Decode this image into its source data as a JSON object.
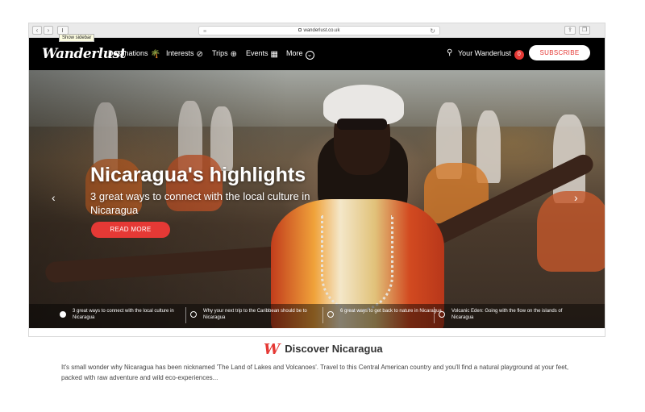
{
  "browser": {
    "url": "wanderlust.co.uk",
    "tooltip": "Show sidebar",
    "back_glyph": "‹",
    "forward_glyph": "›",
    "reload_glyph": "↻",
    "new_tab_glyph": "+"
  },
  "site": {
    "logo": "Wanderlust",
    "nav": [
      {
        "label": "Destinations",
        "icon": "palm-tree-icon",
        "glyph": "🌴"
      },
      {
        "label": "Interests",
        "icon": "compass-icon",
        "glyph": "⊘"
      },
      {
        "label": "Trips",
        "icon": "globe-icon",
        "glyph": "⊕"
      },
      {
        "label": "Events",
        "icon": "calendar-icon",
        "glyph": "▦"
      },
      {
        "label": "More",
        "icon": "chevron-down-circle-icon",
        "glyph": "⌄"
      }
    ],
    "search_glyph": "⚲",
    "your_wanderlust": "Your Wanderlust",
    "notification_count": "0",
    "subscribe": "SUBSCRIBE"
  },
  "hero": {
    "title": "Nicaragua's highlights",
    "subtitle": "3 great ways to connect with the local culture in Nicaragua",
    "read_more": "READ MORE",
    "prev_glyph": "‹",
    "next_glyph": "›",
    "slides": [
      {
        "text": "3 great ways to connect with the local culture in Nicaragua",
        "active": true
      },
      {
        "text": "Why your next trip to the Caribbean should be to Nicaragua",
        "active": false
      },
      {
        "text": "6 great ways to get back to nature in Nicaragua",
        "active": false
      },
      {
        "text": "Volcanic Eden: Going with the flow on the islands of Nicaragua",
        "active": false
      }
    ]
  },
  "discover": {
    "logo_mark": "W",
    "heading": "Discover Nicaragua",
    "body": "It's small wonder why Nicaragua has been nicknamed 'The Land of Lakes and Volcanoes'. Travel to this Central American country and you'll find a natural playground at your feet, packed with raw adventure and wild eco-experiences..."
  },
  "colors": {
    "accent": "#e53935",
    "nav_bg": "#000000"
  }
}
